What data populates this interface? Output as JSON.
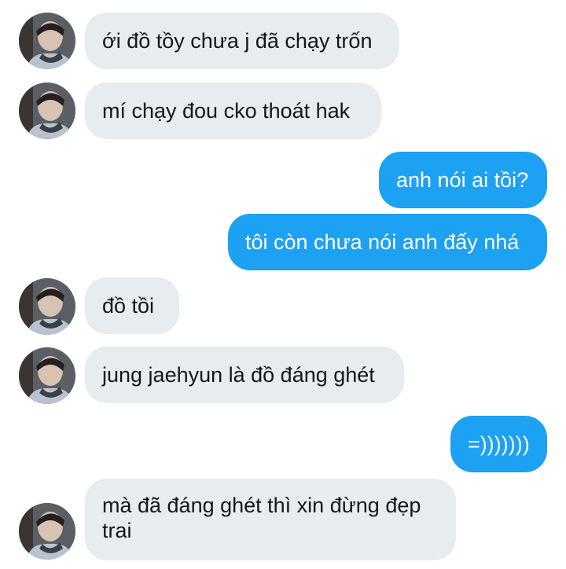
{
  "conversation": {
    "messages": [
      {
        "sender": "them",
        "text": "ới đồ tồy chưa j đã chạy trốn"
      },
      {
        "sender": "them",
        "text": "mí chạy đou cko thoát hak"
      },
      {
        "sender": "me",
        "text": "anh nói ai tồi?"
      },
      {
        "sender": "me",
        "text": "tôi còn chưa nói anh đấy nhá"
      },
      {
        "sender": "them",
        "text": "đồ tồi"
      },
      {
        "sender": "them",
        "text": "jung jaehyun là đồ đáng ghét"
      },
      {
        "sender": "me",
        "text": "=)))))))"
      },
      {
        "sender": "them",
        "text": "mà đã đáng ghét thì xin đừng đẹp trai"
      }
    ]
  },
  "colors": {
    "incoming_bubble": "#e6ecf0",
    "outgoing_bubble": "#1da1f2",
    "incoming_text": "#14171a",
    "outgoing_text": "#ffffff"
  },
  "icons": {
    "contact_avatar": "contact-avatar-photo"
  }
}
